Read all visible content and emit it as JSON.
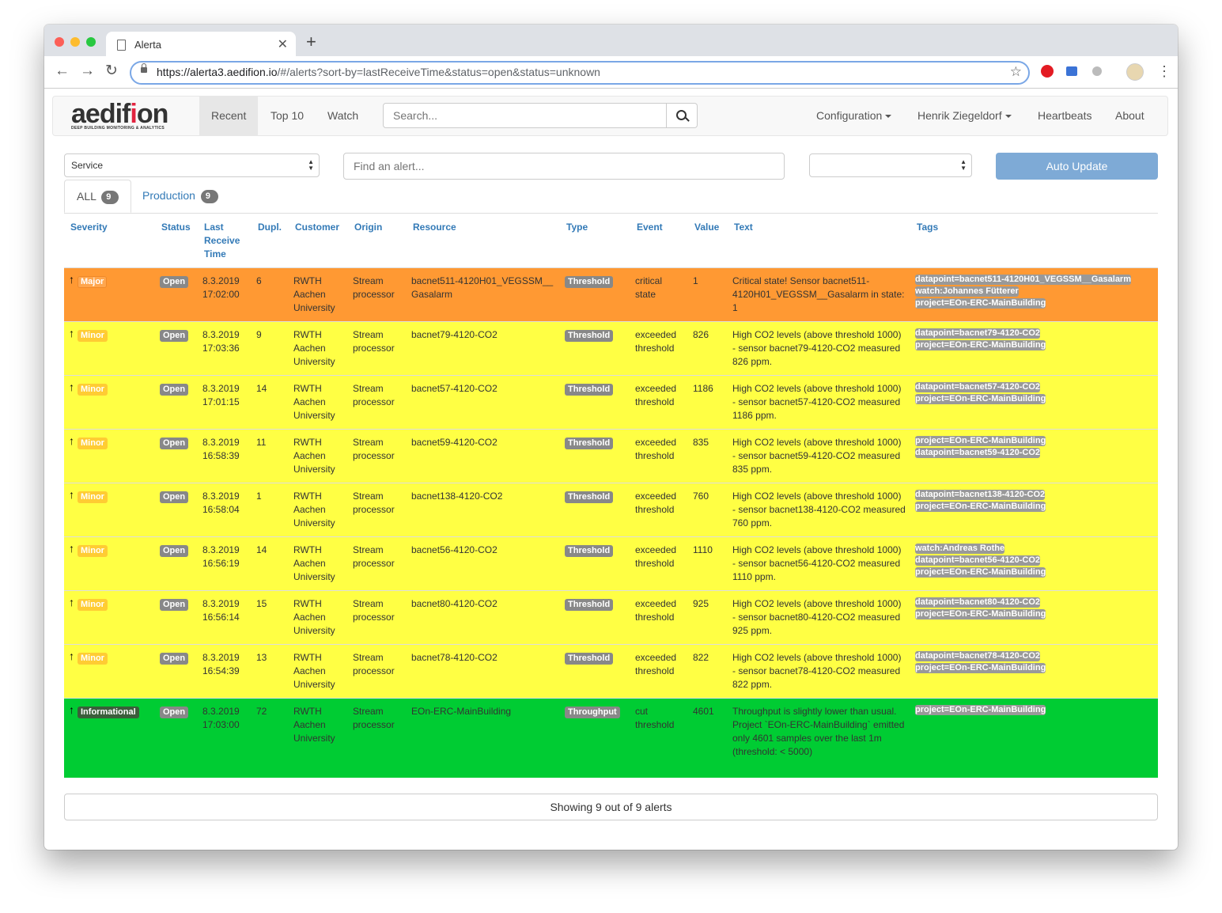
{
  "browser": {
    "tab_title": "Alerta",
    "url_host": "https://alerta3.aedifion.io",
    "url_path": "/#/alerts?sort-by=lastReceiveTime&status=open&status=unknown"
  },
  "navbar": {
    "logo_main": "aedif",
    "logo_accent": "i",
    "logo_tail": "on",
    "logo_sub": "DEEP BUILDING MONITORING & ANALYTICS",
    "links": [
      "Recent",
      "Top 10",
      "Watch"
    ],
    "search_placeholder": "Search...",
    "right_links": [
      "Configuration",
      "Henrik Ziegeldorf",
      "Heartbeats",
      "About"
    ]
  },
  "filters": {
    "service_select": "Service",
    "find_placeholder": "Find an alert...",
    "env_select": "",
    "auto_update": "Auto Update"
  },
  "env_tabs": [
    {
      "label": "ALL",
      "count": "9"
    },
    {
      "label": "Production",
      "count": "9"
    }
  ],
  "columns": [
    "Severity",
    "Status",
    "Last Receive Time",
    "Dupl.",
    "Customer",
    "Origin",
    "Resource",
    "Type",
    "Event",
    "Value",
    "Text",
    "Tags"
  ],
  "colors": {
    "major": "#ff9933",
    "minor": "#ffff44",
    "informational": "#00cc33",
    "link": "#337ab7",
    "auto_update": "#7eaad6"
  },
  "alerts": [
    {
      "severity": "Major",
      "sev_class": "major",
      "status": "Open",
      "time_date": "8.3.2019",
      "time_clock": "17:02:00",
      "dupl": "6",
      "customer": "RWTH Aachen University",
      "origin": "Stream processor",
      "resource": "bacnet511-4120H01_VEGSSM__Gasalarm",
      "type": "Threshold",
      "event": "critical state",
      "value": "1",
      "text": "Critical state! Sensor bacnet511-4120H01_VEGSSM__Gasalarm in state: 1",
      "tags": [
        "datapoint=bacnet511-4120H01_VEGSSM__Gasalarm",
        "watch:Johannes Fütterer",
        "project=EOn-ERC-MainBuilding"
      ]
    },
    {
      "severity": "Minor",
      "sev_class": "minor",
      "status": "Open",
      "time_date": "8.3.2019",
      "time_clock": "17:03:36",
      "dupl": "9",
      "customer": "RWTH Aachen University",
      "origin": "Stream processor",
      "resource": "bacnet79-4120-CO2",
      "type": "Threshold",
      "event": "exceeded threshold",
      "value": "826",
      "text": "High CO2 levels (above threshold 1000) - sensor bacnet79-4120-CO2 measured 826 ppm.",
      "tags": [
        "datapoint=bacnet79-4120-CO2",
        "project=EOn-ERC-MainBuilding"
      ]
    },
    {
      "severity": "Minor",
      "sev_class": "minor",
      "status": "Open",
      "time_date": "8.3.2019",
      "time_clock": "17:01:15",
      "dupl": "14",
      "customer": "RWTH Aachen University",
      "origin": "Stream processor",
      "resource": "bacnet57-4120-CO2",
      "type": "Threshold",
      "event": "exceeded threshold",
      "value": "1186",
      "text": "High CO2 levels (above threshold 1000) - sensor bacnet57-4120-CO2 measured 1186 ppm.",
      "tags": [
        "datapoint=bacnet57-4120-CO2",
        "project=EOn-ERC-MainBuilding"
      ]
    },
    {
      "severity": "Minor",
      "sev_class": "minor",
      "status": "Open",
      "time_date": "8.3.2019",
      "time_clock": "16:58:39",
      "dupl": "11",
      "customer": "RWTH Aachen University",
      "origin": "Stream processor",
      "resource": "bacnet59-4120-CO2",
      "type": "Threshold",
      "event": "exceeded threshold",
      "value": "835",
      "text": "High CO2 levels (above threshold 1000) - sensor bacnet59-4120-CO2 measured 835 ppm.",
      "tags": [
        "project=EOn-ERC-MainBuilding",
        "datapoint=bacnet59-4120-CO2"
      ]
    },
    {
      "severity": "Minor",
      "sev_class": "minor",
      "status": "Open",
      "time_date": "8.3.2019",
      "time_clock": "16:58:04",
      "dupl": "1",
      "customer": "RWTH Aachen University",
      "origin": "Stream processor",
      "resource": "bacnet138-4120-CO2",
      "type": "Threshold",
      "event": "exceeded threshold",
      "value": "760",
      "text": "High CO2 levels (above threshold 1000) - sensor bacnet138-4120-CO2 measured 760 ppm.",
      "tags": [
        "datapoint=bacnet138-4120-CO2",
        "project=EOn-ERC-MainBuilding"
      ]
    },
    {
      "severity": "Minor",
      "sev_class": "minor",
      "status": "Open",
      "time_date": "8.3.2019",
      "time_clock": "16:56:19",
      "dupl": "14",
      "customer": "RWTH Aachen University",
      "origin": "Stream processor",
      "resource": "bacnet56-4120-CO2",
      "type": "Threshold",
      "event": "exceeded threshold",
      "value": "1110",
      "text": "High CO2 levels (above threshold 1000) - sensor bacnet56-4120-CO2 measured 1110 ppm.",
      "tags": [
        "watch:Andreas Rothe",
        "datapoint=bacnet56-4120-CO2",
        "project=EOn-ERC-MainBuilding"
      ]
    },
    {
      "severity": "Minor",
      "sev_class": "minor",
      "status": "Open",
      "time_date": "8.3.2019",
      "time_clock": "16:56:14",
      "dupl": "15",
      "customer": "RWTH Aachen University",
      "origin": "Stream processor",
      "resource": "bacnet80-4120-CO2",
      "type": "Threshold",
      "event": "exceeded threshold",
      "value": "925",
      "text": "High CO2 levels (above threshold 1000) - sensor bacnet80-4120-CO2 measured 925 ppm.",
      "tags": [
        "datapoint=bacnet80-4120-CO2",
        "project=EOn-ERC-MainBuilding"
      ]
    },
    {
      "severity": "Minor",
      "sev_class": "minor",
      "status": "Open",
      "time_date": "8.3.2019",
      "time_clock": "16:54:39",
      "dupl": "13",
      "customer": "RWTH Aachen University",
      "origin": "Stream processor",
      "resource": "bacnet78-4120-CO2",
      "type": "Threshold",
      "event": "exceeded threshold",
      "value": "822",
      "text": "High CO2 levels (above threshold 1000) - sensor bacnet78-4120-CO2 measured 822 ppm.",
      "tags": [
        "datapoint=bacnet78-4120-CO2",
        "project=EOn-ERC-MainBuilding"
      ]
    },
    {
      "severity": "Informational",
      "sev_class": "informational",
      "status": "Open",
      "time_date": "8.3.2019",
      "time_clock": "17:03:00",
      "dupl": "72",
      "customer": "RWTH Aachen University",
      "origin": "Stream processor",
      "resource": "EOn-ERC-MainBuilding",
      "type": "Throughput",
      "event": "cut threshold",
      "value": "4601",
      "text": "Throughput is slightly lower than usual. Project `EOn-ERC-MainBuilding` emitted only 4601 samples over the last 1m (threshold: < 5000)",
      "tags": [
        "project=EOn-ERC-MainBuilding"
      ]
    }
  ],
  "footer_text": "Showing 9 out of 9 alerts"
}
